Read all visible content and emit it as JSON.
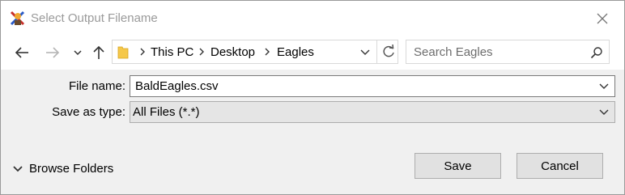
{
  "window": {
    "title": "Select Output Filename",
    "icons": {
      "app": "app-icon",
      "close": "close-icon"
    }
  },
  "navigation": {
    "back_icon": "arrow-left-icon",
    "forward_icon": "arrow-right-icon",
    "recent_icon": "chevron-down-icon",
    "up_icon": "arrow-up-icon",
    "breadcrumb": [
      "This PC",
      "Desktop",
      "Eagles"
    ],
    "refresh_icon": "refresh-icon",
    "search_placeholder": "Search Eagles"
  },
  "form": {
    "file_name_label": "File name:",
    "file_name_value": "BaldEagles.csv",
    "save_type_label": "Save as type:",
    "save_type_value": "All Files (*.*)"
  },
  "footer": {
    "browse_folders_label": "Browse Folders",
    "save_label": "Save",
    "cancel_label": "Cancel"
  },
  "colors": {
    "title_text": "#9a9a9a",
    "form_background": "#f0f0f0",
    "button_face": "#e1e1e1",
    "folder_yellow": "#f5c84a"
  }
}
